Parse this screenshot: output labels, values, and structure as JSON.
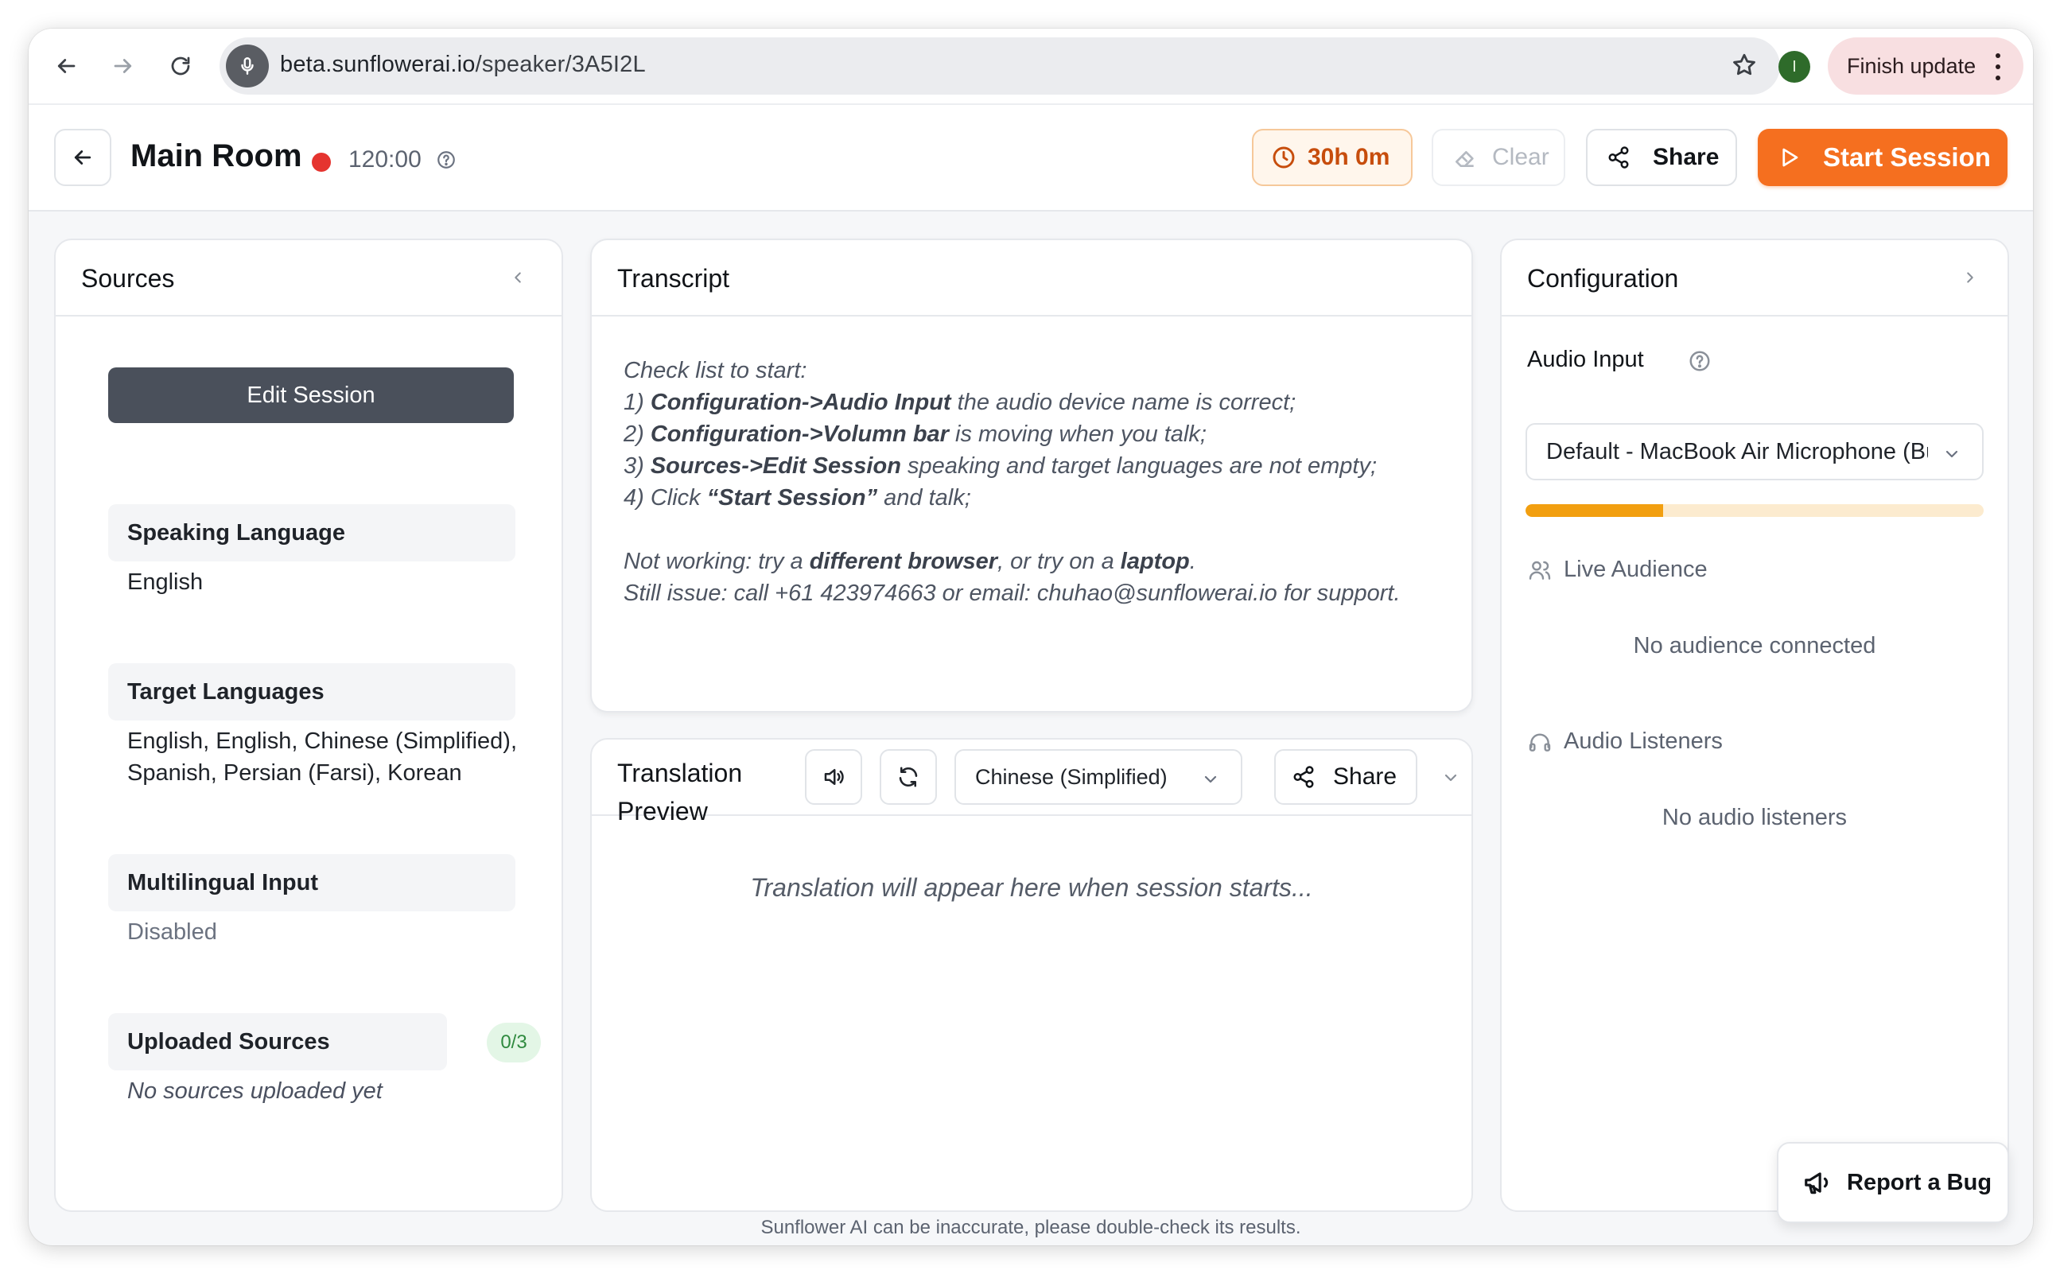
{
  "browser": {
    "url_host": "beta.sunflowerai.io",
    "url_path": "/speaker/3A5I2L",
    "profile_initial": "I",
    "finish_update_label": "Finish update"
  },
  "header": {
    "room_title": "Main Room",
    "timer": "120:00",
    "time_remaining": "30h 0m",
    "clear_label": "Clear",
    "share_label": "Share",
    "start_label": "Start Session",
    "accent_color": "#f56f1f"
  },
  "sources": {
    "title": "Sources",
    "edit_session_label": "Edit Session",
    "speaking_language_label": "Speaking Language",
    "speaking_language_value": "English",
    "target_languages_label": "Target Languages",
    "target_languages_line1": "English, English, Chinese (Simplified),",
    "target_languages_line2": "Spanish, Persian (Farsi), Korean",
    "multilingual_label": "Multilingual Input",
    "multilingual_value": "Disabled",
    "uploaded_label": "Uploaded Sources",
    "uploaded_count": "0/3",
    "uploaded_empty": "No sources uploaded yet"
  },
  "transcript": {
    "title": "Transcript",
    "intro": "Check list to start:",
    "step1_num": "1) ",
    "step1_bold": "Configuration->Audio Input",
    "step1_rest": " the audio device name is correct;",
    "step2_num": "2) ",
    "step2_bold": "Configuration->Volumn bar",
    "step2_rest": " is moving when you talk;",
    "step3_num": "3) ",
    "step3_bold": "Sources->Edit Session",
    "step3_rest": " speaking and target languages are not empty;",
    "step4_num": "4) Click ",
    "step4_bold": "“Start Session”",
    "step4_rest": " and talk;",
    "help_a": "Not working: try a ",
    "help_b": "different browser",
    "help_c": ", or try on a ",
    "help_d": "laptop",
    "help_e": ".",
    "support": "Still issue: call +61 423974663 or email: chuhao@sunflowerai.io for support."
  },
  "translation": {
    "title": "Translation Preview",
    "language": "Chinese (Simplified)",
    "share_label": "Share",
    "placeholder": "Translation will appear here when session starts..."
  },
  "configuration": {
    "title": "Configuration",
    "audio_input_label": "Audio Input",
    "audio_device": "Default - MacBook Air Microphone (Built-in)",
    "volume_level": 0.3,
    "live_audience_label": "Live Audience",
    "live_audience_empty": "No audience connected",
    "audio_listeners_label": "Audio Listeners",
    "audio_listeners_empty": "No audio listeners"
  },
  "footer": {
    "disclaimer": "Sunflower AI can be inaccurate, please double-check its results.",
    "report_bug_label": "Report a Bug"
  }
}
